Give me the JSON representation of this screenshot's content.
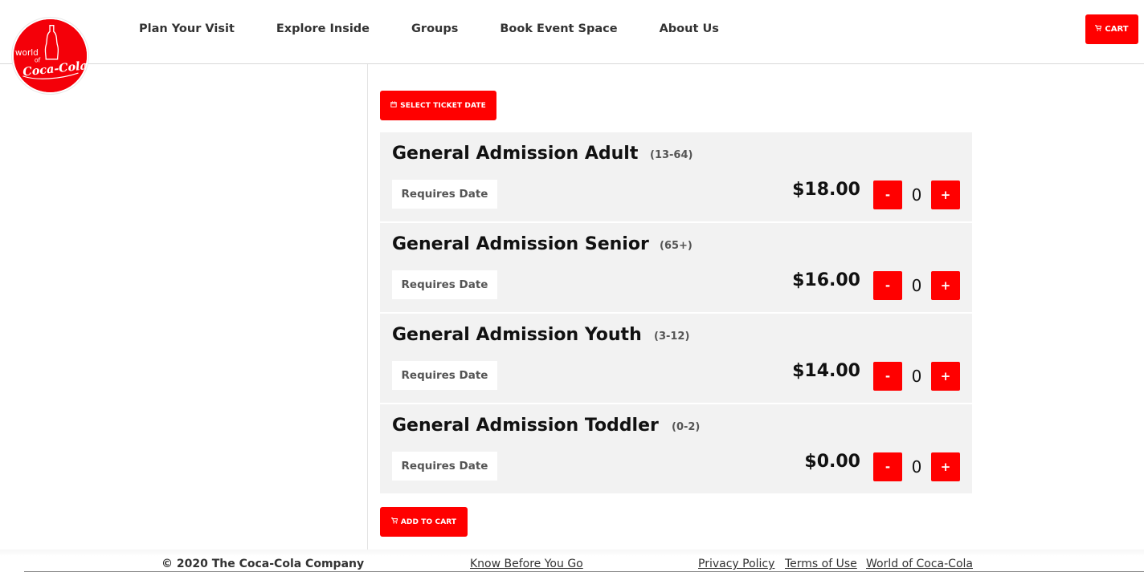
{
  "brand": {
    "logo_alt": "World of Coca-Cola",
    "logo_text_world": "world",
    "logo_text_of": "of",
    "logo_text_brand": "Coca-Cola",
    "accent_color": "#ff0000"
  },
  "nav": {
    "items": [
      {
        "label": "Plan Your Visit"
      },
      {
        "label": "Explore Inside"
      },
      {
        "label": "Groups"
      },
      {
        "label": "Book Event Space"
      },
      {
        "label": "About Us"
      }
    ]
  },
  "header": {
    "cart_label": "CART",
    "cart_icon": "cart-icon"
  },
  "booking": {
    "select_date_label": "SELECT TICKET DATE",
    "select_date_icon": "calendar-icon",
    "add_to_cart_label": "ADD TO CART",
    "add_to_cart_icon": "cart-icon",
    "tickets": [
      {
        "title": "General Admission Adult",
        "age": "(13-64)",
        "requirement": "Requires Date",
        "price": "$18.00",
        "minus": "-",
        "quantity": "0",
        "plus": "+"
      },
      {
        "title": "General Admission Senior",
        "age": "(65+)",
        "requirement": "Requires Date",
        "price": "$16.00",
        "minus": "-",
        "quantity": "0",
        "plus": "+"
      },
      {
        "title": "General Admission Youth",
        "age": "(3-12)",
        "requirement": "Requires Date",
        "price": "$14.00",
        "minus": "-",
        "quantity": "0",
        "plus": "+"
      },
      {
        "title": "General Admission Toddler",
        "age": "(0-2)",
        "requirement": "Requires Date",
        "price": "$0.00",
        "minus": "-",
        "quantity": "0",
        "plus": "+"
      }
    ]
  },
  "footer": {
    "copyright": "© 2020 The Coca-Cola Company",
    "know_before": "Know Before You Go",
    "privacy": "Privacy Policy",
    "terms": "Terms of Use",
    "world": "World of Coca-Cola"
  }
}
